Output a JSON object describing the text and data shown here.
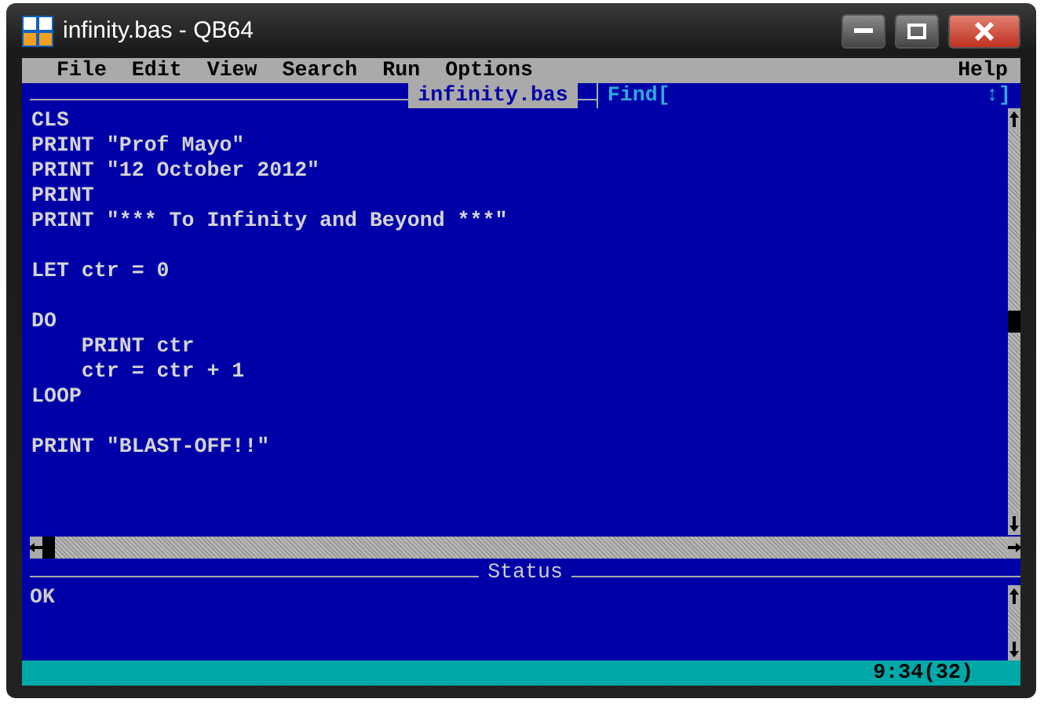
{
  "window": {
    "title": "infinity.bas - QB64"
  },
  "menu": [
    "File",
    "Edit",
    "View",
    "Search",
    "Run",
    "Options"
  ],
  "help_menu": "Help",
  "editor": {
    "file_tab": "infinity.bas",
    "find_label": "Find[",
    "find_toggle": "↕]",
    "code_blocks": [
      [
        "CLS",
        "PRINT \"Prof Mayo\"",
        "PRINT \"12 October 2012\"",
        "PRINT",
        "PRINT \"*** To Infinity and Beyond ***\""
      ],
      [
        "LET ctr = 0"
      ],
      [
        "DO",
        "    PRINT ctr",
        "    ctr = ctr + 1",
        "LOOP"
      ],
      [
        "PRINT \"BLAST-OFF!!\""
      ]
    ]
  },
  "status": {
    "title": "Status",
    "message": "OK"
  },
  "status_bar": {
    "position": "9:34(32)"
  }
}
